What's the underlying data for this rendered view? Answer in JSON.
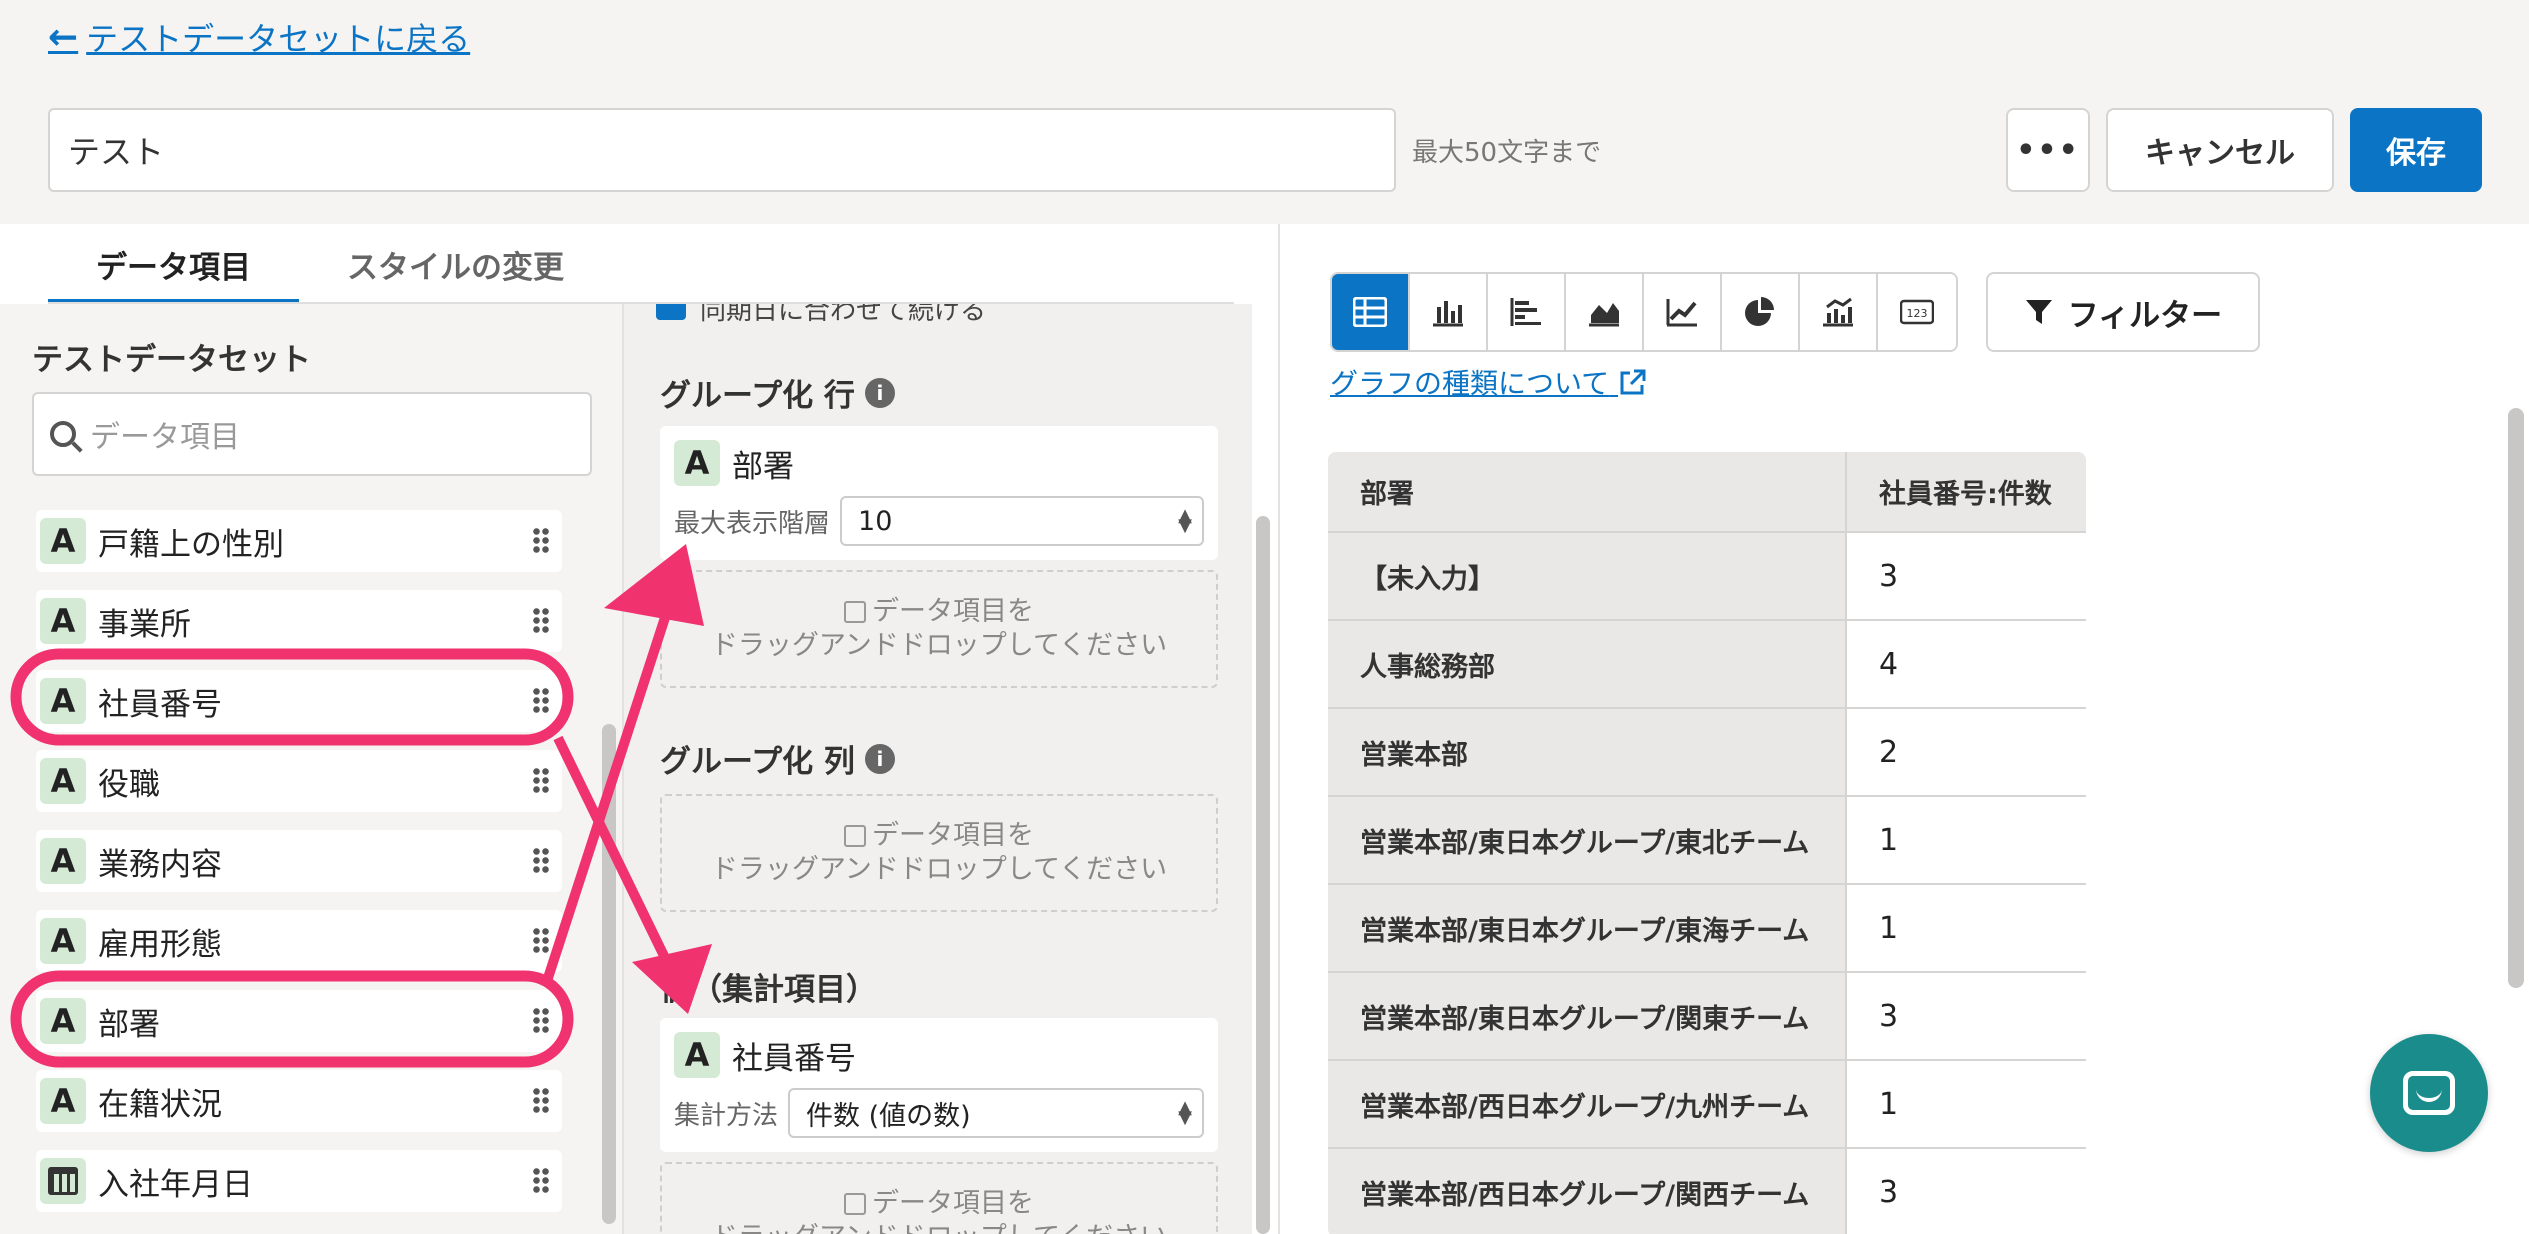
{
  "header": {
    "back_link": "テストデータセットに戻る",
    "name_value": "テスト",
    "name_hint": "最大50文字まで",
    "more_label": "•••",
    "cancel_label": "キャンセル",
    "save_label": "保存"
  },
  "editor": {
    "tabs": [
      {
        "label": "データ項目",
        "active": true
      },
      {
        "label": "スタイルの変更",
        "active": false
      }
    ],
    "dataset_title": "テストデータセット",
    "search_placeholder": "データ項目",
    "fields": [
      {
        "type": "A",
        "label": "戸籍上の性別"
      },
      {
        "type": "A",
        "label": "事業所"
      },
      {
        "type": "A",
        "label": "社員番号",
        "highlighted": true
      },
      {
        "type": "A",
        "label": "役職"
      },
      {
        "type": "A",
        "label": "業務内容"
      },
      {
        "type": "A",
        "label": "雇用形態"
      },
      {
        "type": "A",
        "label": "部署",
        "highlighted": true
      },
      {
        "type": "A",
        "label": "在籍状況"
      },
      {
        "type": "calendar-icon",
        "label": "入社年月日"
      }
    ],
    "config": {
      "cut_checkbox_label": "同期日に合わせて続ける",
      "group_row_title": "グループ化 行",
      "group_row_field": {
        "type": "A",
        "label": "部署",
        "option_label": "最大表示階層",
        "option_value": "10"
      },
      "drop_hint_line1": "データ項目を",
      "drop_hint_line2": "ドラッグアンドドロップしてください",
      "group_col_title": "グループ化 列",
      "values_title": "値（集計項目）",
      "values_field": {
        "type": "A",
        "label": "社員番号",
        "option_label": "集計方法",
        "option_value": "件数 (値の数)"
      }
    }
  },
  "preview": {
    "chart_type_buttons": [
      "table-icon",
      "column-chart-icon",
      "bar-chart-icon",
      "area-chart-icon",
      "line-chart-icon",
      "pie-chart-icon",
      "combo-chart-icon",
      "number-icon"
    ],
    "active_chart_type": "table-icon",
    "number_icon_label": "123",
    "filter_label": "フィルター",
    "chart_help_link": "グラフの種類について",
    "table": {
      "headers": [
        "部署",
        "社員番号:件数"
      ],
      "rows": [
        [
          "【未入力】",
          "3"
        ],
        [
          "人事総務部",
          "4"
        ],
        [
          "営業本部",
          "2"
        ],
        [
          "営業本部/東日本グループ/東北チーム",
          "1"
        ],
        [
          "営業本部/東日本グループ/東海チーム",
          "1"
        ],
        [
          "営業本部/東日本グループ/関東チーム",
          "3"
        ],
        [
          "営業本部/西日本グループ/九州チーム",
          "1"
        ],
        [
          "営業本部/西日本グループ/関西チーム",
          "3"
        ]
      ]
    }
  },
  "colors": {
    "accent": "#0b74c4",
    "highlight": "#f0326e",
    "chat": "#1a8c8c"
  }
}
